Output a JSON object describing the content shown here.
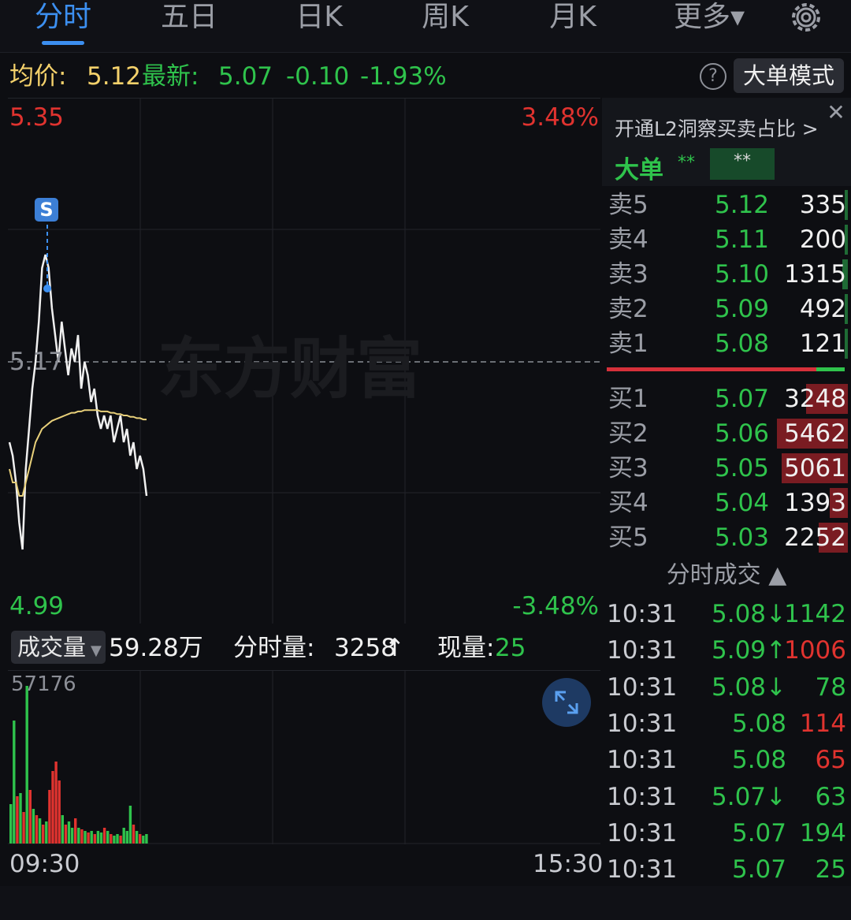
{
  "tabs": [
    {
      "label": "分时",
      "active": true
    },
    {
      "label": "五日",
      "active": false
    },
    {
      "label": "日K",
      "active": false
    },
    {
      "label": "周K",
      "active": false
    },
    {
      "label": "月K",
      "active": false
    },
    {
      "label": "更多▾",
      "active": false
    }
  ],
  "info": {
    "avg_label": "均价:",
    "avg_value": "5.12",
    "latest_label": "最新:",
    "latest_value": "5.07",
    "change": "-0.10",
    "change_pct": "-1.93%",
    "mode_button": "大单模式"
  },
  "chart": {
    "high_price": "5.35",
    "high_pct": "3.48%",
    "mid_price": "5.17",
    "low_price": "4.99",
    "low_pct": "-3.48%",
    "marker": "S",
    "watermark": "东方财富",
    "start_time": "09:30",
    "end_time": "15:30"
  },
  "chart_data": {
    "type": "line",
    "ylim": [
      4.99,
      5.35
    ],
    "reference_price": 5.17,
    "series": [
      {
        "values": [
          5.11,
          5.1,
          5.08,
          5.05,
          5.03,
          5.09,
          5.12,
          5.15,
          5.17,
          5.2,
          5.24,
          5.25,
          5.24,
          5.21,
          5.19,
          5.17,
          5.2,
          5.18,
          5.16,
          5.18,
          5.17,
          5.19,
          5.15,
          5.17,
          5.16,
          5.14,
          5.15,
          5.13,
          5.12,
          5.13,
          5.12,
          5.13,
          5.11,
          5.12,
          5.13,
          5.11,
          5.12,
          5.1,
          5.11,
          5.09,
          5.1,
          5.09,
          5.07
        ],
        "color": "#f0f0f0"
      },
      {
        "values": [
          5.09,
          5.08,
          5.08,
          5.07,
          5.07,
          5.08,
          5.09,
          5.1,
          5.11,
          5.115,
          5.12,
          5.122,
          5.124,
          5.126,
          5.127,
          5.128,
          5.129,
          5.13,
          5.131,
          5.132,
          5.132,
          5.133,
          5.133,
          5.134,
          5.134,
          5.134,
          5.134,
          5.134,
          5.133,
          5.133,
          5.133,
          5.132,
          5.132,
          5.131,
          5.131,
          5.13,
          5.13,
          5.129,
          5.129,
          5.128,
          5.128,
          5.127,
          5.127
        ],
        "color": "#e8d07a"
      }
    ]
  },
  "volume": {
    "label": "成交量",
    "total": "59.28万",
    "period_label": "分时量:",
    "period_value": "3258",
    "period_arrow": "↑",
    "current_label": "现量:",
    "current_value": "25",
    "max_value": "57176",
    "bars": [
      {
        "v": 0.25,
        "c": "g"
      },
      {
        "v": 0.78,
        "c": "g"
      },
      {
        "v": 0.3,
        "c": "r"
      },
      {
        "v": 0.32,
        "c": "g"
      },
      {
        "v": 0.2,
        "c": "r"
      },
      {
        "v": 1.0,
        "c": "g"
      },
      {
        "v": 0.34,
        "c": "r"
      },
      {
        "v": 0.22,
        "c": "g"
      },
      {
        "v": 0.18,
        "c": "r"
      },
      {
        "v": 0.16,
        "c": "g"
      },
      {
        "v": 0.12,
        "c": "r"
      },
      {
        "v": 0.14,
        "c": "g"
      },
      {
        "v": 0.34,
        "c": "r"
      },
      {
        "v": 0.46,
        "c": "r"
      },
      {
        "v": 0.52,
        "c": "r"
      },
      {
        "v": 0.4,
        "c": "r"
      },
      {
        "v": 0.18,
        "c": "g"
      },
      {
        "v": 0.12,
        "c": "r"
      },
      {
        "v": 0.14,
        "c": "g"
      },
      {
        "v": 0.1,
        "c": "g"
      },
      {
        "v": 0.16,
        "c": "r"
      },
      {
        "v": 0.1,
        "c": "g"
      },
      {
        "v": 0.09,
        "c": "r"
      },
      {
        "v": 0.08,
        "c": "g"
      },
      {
        "v": 0.07,
        "c": "r"
      },
      {
        "v": 0.08,
        "c": "g"
      },
      {
        "v": 0.06,
        "c": "r"
      },
      {
        "v": 0.08,
        "c": "g"
      },
      {
        "v": 0.07,
        "c": "g"
      },
      {
        "v": 0.1,
        "c": "r"
      },
      {
        "v": 0.08,
        "c": "g"
      },
      {
        "v": 0.06,
        "c": "r"
      },
      {
        "v": 0.05,
        "c": "g"
      },
      {
        "v": 0.06,
        "c": "g"
      },
      {
        "v": 0.05,
        "c": "r"
      },
      {
        "v": 0.1,
        "c": "g"
      },
      {
        "v": 0.08,
        "c": "g"
      },
      {
        "v": 0.24,
        "c": "g"
      },
      {
        "v": 0.12,
        "c": "r"
      },
      {
        "v": 0.08,
        "c": "g"
      },
      {
        "v": 0.06,
        "c": "r"
      },
      {
        "v": 0.05,
        "c": "g"
      },
      {
        "v": 0.06,
        "c": "g"
      }
    ]
  },
  "panel": {
    "l2_link": "开通L2洞察买卖占比 >",
    "big_label": "大单",
    "big_v1": "**",
    "big_v2": "**",
    "asks": [
      {
        "label": "卖5",
        "price": "5.12",
        "vol": "335",
        "bar": 0.02
      },
      {
        "label": "卖4",
        "price": "5.11",
        "vol": "200",
        "bar": 0.01
      },
      {
        "label": "卖3",
        "price": "5.10",
        "vol": "1315",
        "bar": 0.08
      },
      {
        "label": "卖2",
        "price": "5.09",
        "vol": "492",
        "bar": 0.03
      },
      {
        "label": "卖1",
        "price": "5.08",
        "vol": "121",
        "bar": 0.01
      }
    ],
    "bids": [
      {
        "label": "买1",
        "price": "5.07",
        "vol": "3248",
        "bar": 0.59
      },
      {
        "label": "买2",
        "price": "5.06",
        "vol": "5462",
        "bar": 1.0
      },
      {
        "label": "买3",
        "price": "5.05",
        "vol": "5061",
        "bar": 0.93
      },
      {
        "label": "买4",
        "price": "5.04",
        "vol": "1393",
        "bar": 0.26
      },
      {
        "label": "买5",
        "price": "5.03",
        "vol": "2252",
        "bar": 0.41
      }
    ],
    "trades_header": "分时成交 ▲",
    "trades": [
      {
        "time": "10:31",
        "price": "5.08↓",
        "vol": "1142",
        "pc": "green",
        "vc": "green"
      },
      {
        "time": "10:31",
        "price": "5.09↑",
        "vol": "1006",
        "pc": "green",
        "vc": "red"
      },
      {
        "time": "10:31",
        "price": "5.08↓",
        "vol": "78",
        "pc": "green",
        "vc": "green"
      },
      {
        "time": "10:31",
        "price": "5.08",
        "vol": "114",
        "pc": "green",
        "vc": "red"
      },
      {
        "time": "10:31",
        "price": "5.08",
        "vol": "65",
        "pc": "green",
        "vc": "red"
      },
      {
        "time": "10:31",
        "price": "5.07↓",
        "vol": "63",
        "pc": "green",
        "vc": "green"
      },
      {
        "time": "10:31",
        "price": "5.07",
        "vol": "194",
        "pc": "green",
        "vc": "green"
      },
      {
        "time": "10:31",
        "price": "5.07",
        "vol": "25",
        "pc": "green",
        "vc": "green"
      }
    ]
  }
}
